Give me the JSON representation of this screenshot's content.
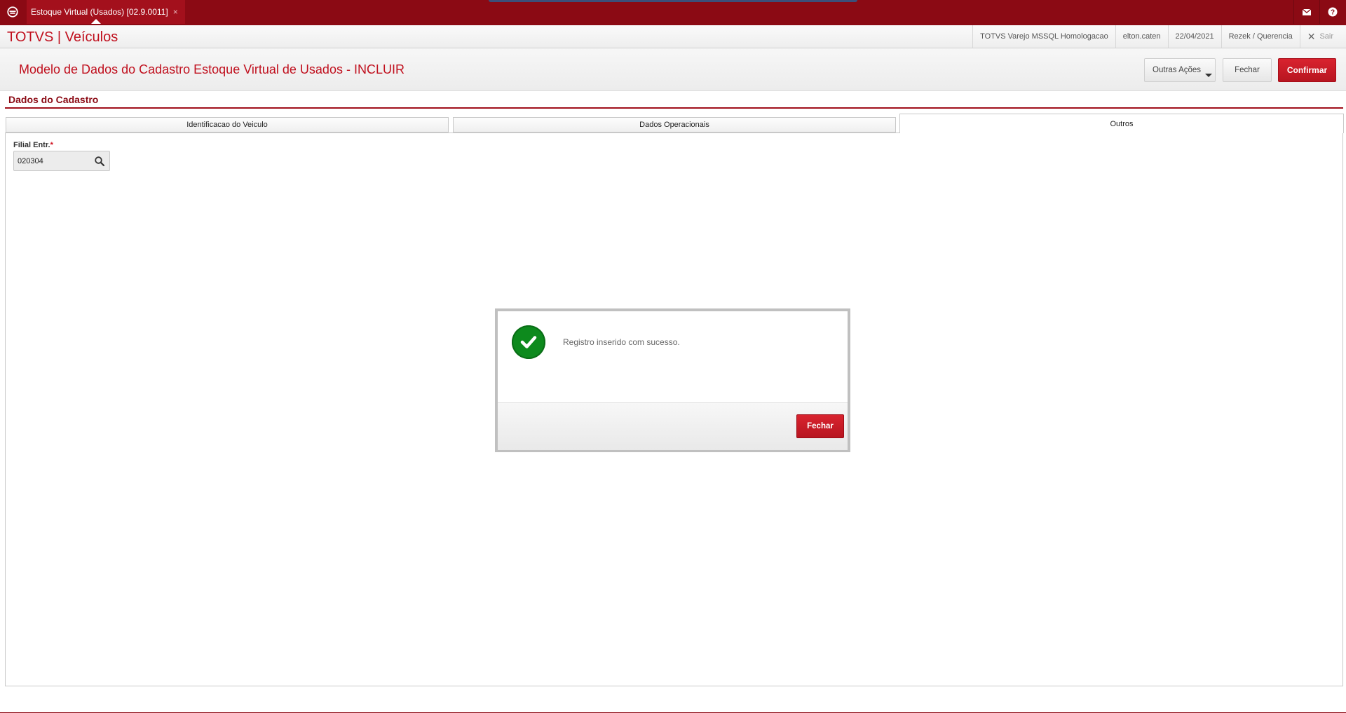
{
  "topbar": {
    "tab_label": "Estoque Virtual (Usados) [02.9.0011]",
    "tab_close": "×",
    "icons": [
      "totvs-home-icon",
      "mail-icon",
      "help-icon"
    ]
  },
  "header": {
    "brand": "TOTVS | Veículos",
    "environment": "TOTVS Varejo MSSQL Homologacao",
    "user": "elton.caten",
    "date": "22/04/2021",
    "branch": "Rezek / Querencia",
    "exit_label": "Sair"
  },
  "page": {
    "title": "Modelo de Dados do Cadastro Estoque Virtual de Usados - INCLUIR",
    "buttons": {
      "other_actions": "Outras Ações",
      "close": "Fechar",
      "confirm": "Confirmar"
    },
    "section_title": "Dados do Cadastro",
    "tabs": [
      {
        "label": "Identificacao do Veiculo",
        "active": false
      },
      {
        "label": "Dados Operacionais",
        "active": false
      },
      {
        "label": "Outros",
        "active": true
      }
    ],
    "fields": {
      "filial_label": "Filial Entr.",
      "filial_required": "*",
      "filial_value": "020304"
    }
  },
  "modal": {
    "message": "Registro inserido com sucesso.",
    "close_label": "Fechar",
    "icon": "success-check-icon"
  },
  "colors": {
    "brand_red": "#8b0a14",
    "accent_red": "#c0101e",
    "success_green": "#0d8a1d"
  }
}
